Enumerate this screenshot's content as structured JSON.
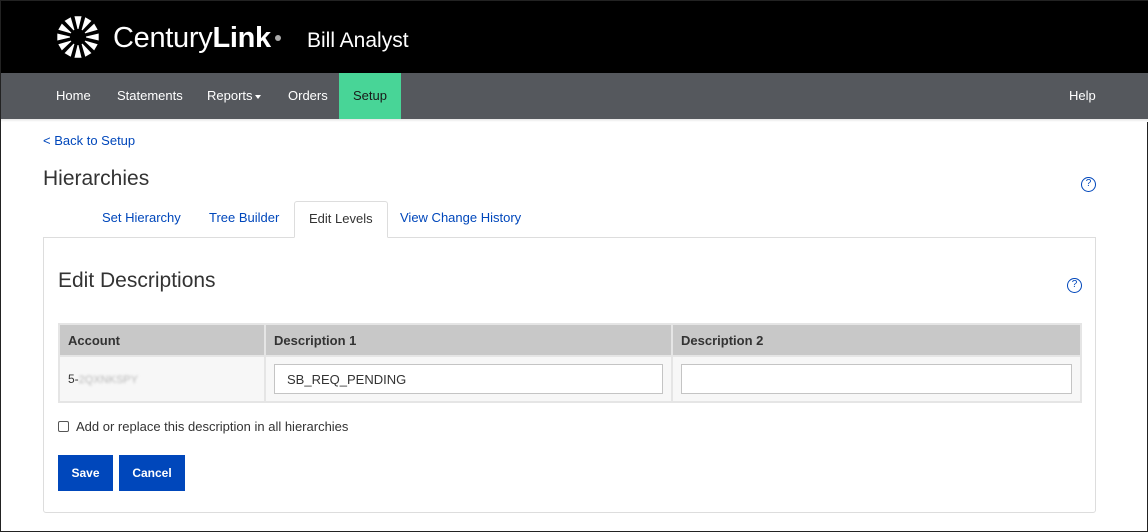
{
  "header": {
    "brand_light": "Century",
    "brand_bold": "Link",
    "app_name": "Bill Analyst",
    "logo_icon": "starburst-logo-icon"
  },
  "nav": {
    "items": [
      {
        "label": "Home"
      },
      {
        "label": "Statements"
      },
      {
        "label": "Reports",
        "has_dropdown": true
      },
      {
        "label": "Orders"
      },
      {
        "label": "Setup",
        "active": true
      }
    ],
    "help_label": "Help",
    "active_color": "#48d597"
  },
  "page": {
    "back_link": "< Back to Setup",
    "title": "Hierarchies",
    "help_icon": "?"
  },
  "tabs": [
    {
      "label": "Set Hierarchy"
    },
    {
      "label": "Tree Builder"
    },
    {
      "label": "Edit Levels",
      "active": true
    },
    {
      "label": "View Change History"
    }
  ],
  "panel": {
    "title": "Edit Descriptions",
    "help_icon": "?",
    "table": {
      "columns": [
        "Account",
        "Description 1",
        "Description 2"
      ],
      "rows": [
        {
          "account_prefix": "5-",
          "account_masked": "2QXNKSPY",
          "description_1": "SB_REQ_PENDING",
          "description_2": ""
        }
      ]
    },
    "checkbox_label": "Add or replace this description in all hierarchies",
    "checkbox_checked": false,
    "save_label": "Save",
    "cancel_label": "Cancel"
  },
  "colors": {
    "primary_button": "#0047bb",
    "link": "#0047bb",
    "nav_bg": "#55585d",
    "header_bg": "#000000"
  }
}
